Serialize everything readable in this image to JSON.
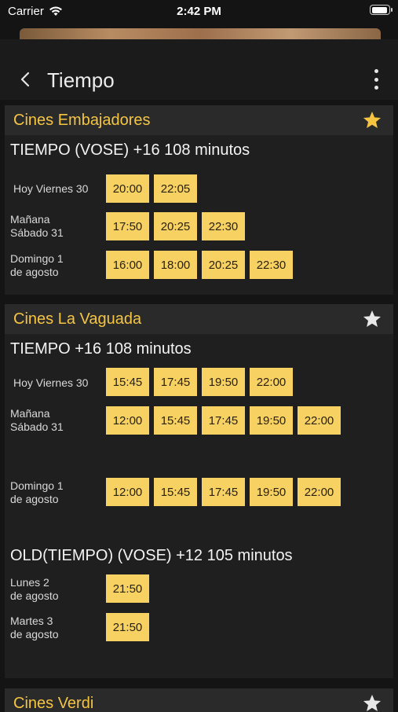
{
  "status": {
    "carrier": "Carrier",
    "time": "2:42 PM"
  },
  "nav": {
    "title": "Tiempo"
  },
  "colors": {
    "accent": "#f5c542",
    "time_bg": "#f7d162",
    "bg": "#141414",
    "card": "#1f1f1f"
  },
  "cinemas": [
    {
      "name": "Cines Embajadores",
      "favorite": true,
      "movies": [
        {
          "title": "TIEMPO (VOSE) +16 108 minutos",
          "days": [
            {
              "label": "Hoy Viernes 30",
              "times": [
                "20:00",
                "22:05"
              ]
            },
            {
              "label": "Mañana\nSábado 31",
              "times": [
                "17:50",
                "20:25",
                "22:30"
              ]
            },
            {
              "label": "Domingo 1\nde agosto",
              "times": [
                "16:00",
                "18:00",
                "20:25",
                "22:30"
              ]
            }
          ]
        }
      ]
    },
    {
      "name": "Cines La Vaguada",
      "favorite": false,
      "movies": [
        {
          "title": "TIEMPO +16 108 minutos",
          "days": [
            {
              "label": "Hoy Viernes 30",
              "times": [
                "15:45",
                "17:45",
                "19:50",
                "22:00"
              ]
            },
            {
              "label": "Mañana\nSábado 31",
              "times": [
                "12:00",
                "15:45",
                "17:45",
                "19:50",
                "22:00"
              ]
            },
            {
              "label": "Domingo 1\nde agosto",
              "times": [
                "12:00",
                "15:45",
                "17:45",
                "19:50",
                "22:00"
              ]
            }
          ]
        },
        {
          "title": "OLD(TIEMPO) (VOSE) +12 105 minutos",
          "days": [
            {
              "label": "Lunes 2\nde agosto",
              "times": [
                "21:50"
              ]
            },
            {
              "label": "Martes 3\nde agosto",
              "times": [
                "21:50"
              ]
            }
          ]
        }
      ]
    },
    {
      "name": "Cines Verdi",
      "favorite": false,
      "movies": []
    }
  ]
}
